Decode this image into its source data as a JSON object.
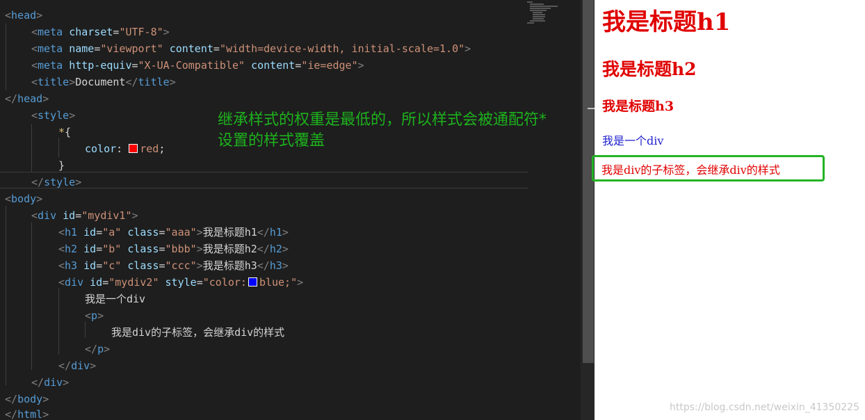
{
  "editor": {
    "lines": [
      [
        "<head>"
      ],
      [
        "<meta charset=\"UTF-8\">"
      ],
      [
        "<meta name=\"viewport\" content=\"width=device-width, initial-scale=1.0\">"
      ],
      [
        "<meta http-equiv=\"X-UA-Compatible\" content=\"ie=edge\">"
      ],
      [
        "<title>Document</title>"
      ],
      [
        "</head>"
      ],
      [
        "<style>"
      ],
      [
        "*{"
      ],
      [
        "color: red;"
      ],
      [
        "}"
      ],
      [
        "</style>"
      ],
      [
        "<body>"
      ],
      [
        "<div id=\"mydiv1\">"
      ],
      [
        "<h1 id=\"a\" class=\"aaa\">我是标题h1</h1>"
      ],
      [
        "<h2 id=\"b\" class=\"bbb\">我是标题h2</h2>"
      ],
      [
        "<h3 id=\"c\" class=\"ccc\">我是标题h3</h3>"
      ],
      [
        "<div id=\"mydiv2\" style=\"color: blue;\">"
      ],
      [
        "我是一个div"
      ],
      [
        "<p>"
      ],
      [
        "我是div的子标签，会继承div的样式"
      ],
      [
        "</p>"
      ],
      [
        "</div>"
      ],
      [
        "</div>"
      ],
      [
        "</body>"
      ],
      [
        "</html>"
      ]
    ],
    "annotation": "继承样式的权重是最低的，所以样式会被通配符*\n设置的样式覆盖",
    "swatch_red": "#ff0000",
    "swatch_blue": "#0000ff"
  },
  "preview": {
    "h1": "我是标题h1",
    "h2": "我是标题h2",
    "h3": "我是标题h3",
    "div_text": "我是一个div",
    "p_text": "我是div的子标签，会继承div的样式",
    "watermark": "https://blog.csdn.net/weixin_41350225"
  }
}
